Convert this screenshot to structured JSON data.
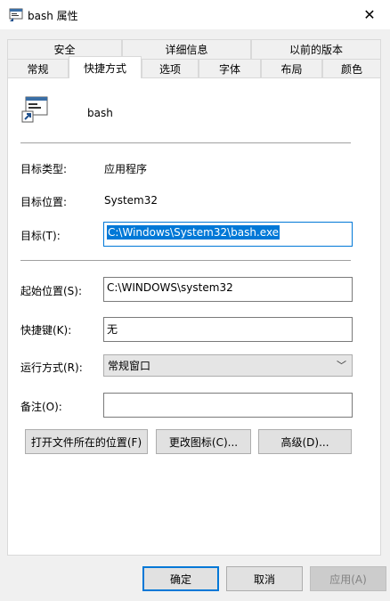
{
  "window": {
    "title": "bash 属性",
    "close_glyph": "✕"
  },
  "tabs_row1": [
    "安全",
    "详细信息",
    "以前的版本"
  ],
  "tabs_row2": [
    "常规",
    "快捷方式",
    "选项",
    "字体",
    "布局",
    "颜色"
  ],
  "shortcut": {
    "name": "bash",
    "target_type_label": "目标类型:",
    "target_type_value": "应用程序",
    "target_location_label": "目标位置:",
    "target_location_value": "System32",
    "target_label": "目标(T):",
    "target_value": "C:\\Windows\\System32\\bash.exe",
    "start_in_label": "起始位置(S):",
    "start_in_value": "C:\\WINDOWS\\system32",
    "hotkey_label": "快捷键(K):",
    "hotkey_value": "无",
    "run_label": "运行方式(R):",
    "run_value": "常规窗口",
    "comment_label": "备注(O):",
    "comment_value": ""
  },
  "buttons": {
    "open_location": "打开文件所在的位置(F)",
    "change_icon": "更改图标(C)...",
    "advanced": "高级(D)...",
    "ok": "确定",
    "cancel": "取消",
    "apply": "应用(A)"
  },
  "colors": {
    "accent": "#0078d7",
    "selection": "#0078d7"
  }
}
